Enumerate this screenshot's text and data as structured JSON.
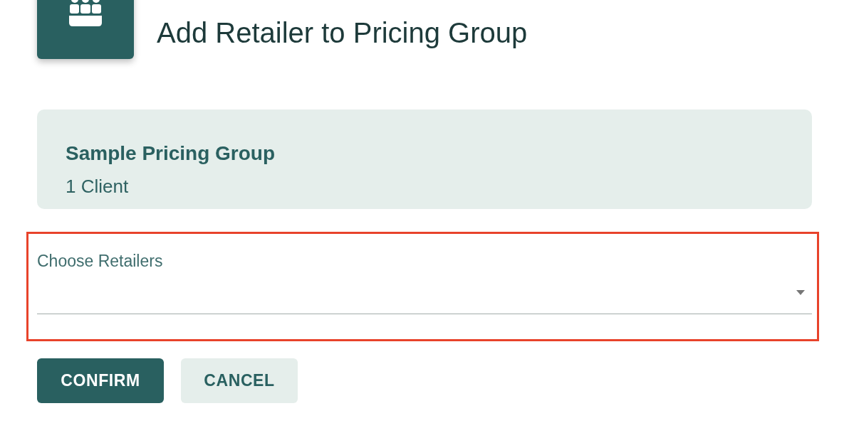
{
  "header": {
    "title": "Add Retailer to Pricing Group"
  },
  "group_card": {
    "name": "Sample Pricing Group",
    "client_count": "1 Client"
  },
  "retailer_select": {
    "label": "Choose Retailers",
    "highlighted": true
  },
  "buttons": [
    {
      "label": "CONFIRM",
      "kind": "primary"
    },
    {
      "label": "CANCEL",
      "kind": "secondary"
    }
  ]
}
